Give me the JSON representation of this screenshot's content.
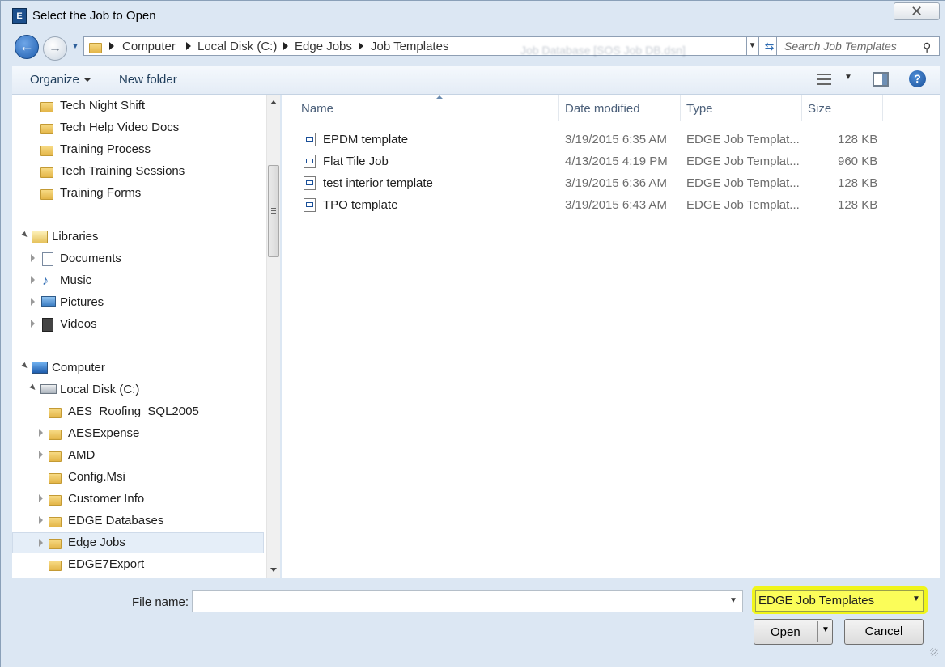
{
  "window": {
    "title": "Select the Job to Open",
    "app_icon_letter": "E"
  },
  "nav": {
    "breadcrumbs": [
      "Computer",
      "Local Disk (C:)",
      "Edge Jobs",
      "Job Templates"
    ],
    "search_placeholder": "Search Job Templates",
    "background_blur_text": "Job Database [SOS Job DB.dsn]"
  },
  "toolbar": {
    "organize": "Organize",
    "new_folder": "New folder"
  },
  "navpane": {
    "top_folders": [
      "Tech Night Shift",
      "Tech Help Video Docs",
      "Training Process",
      "Tech Training Sessions",
      "Training Forms"
    ],
    "libraries_label": "Libraries",
    "libraries": [
      "Documents",
      "Music",
      "Pictures",
      "Videos"
    ],
    "computer_label": "Computer",
    "local_disk_label": "Local Disk (C:)",
    "disk_folders": [
      "AES_Roofing_SQL2005",
      "AESExpense",
      "AMD",
      "Config.Msi",
      "Customer Info",
      "EDGE Databases",
      "Edge Jobs",
      "EDGE7Export"
    ],
    "selected_folder": "Edge Jobs"
  },
  "files": {
    "columns": [
      "Name",
      "Date modified",
      "Type",
      "Size"
    ],
    "rows": [
      {
        "name": "EPDM template",
        "date": "3/19/2015 6:35 AM",
        "type": "EDGE Job Templat...",
        "size": "128 KB"
      },
      {
        "name": "Flat Tile Job",
        "date": "4/13/2015 4:19 PM",
        "type": "EDGE Job Templat...",
        "size": "960 KB"
      },
      {
        "name": "test interior template",
        "date": "3/19/2015 6:36 AM",
        "type": "EDGE Job Templat...",
        "size": "128 KB"
      },
      {
        "name": "TPO template",
        "date": "3/19/2015 6:43 AM",
        "type": "EDGE Job Templat...",
        "size": "128 KB"
      }
    ]
  },
  "footer": {
    "file_name_label": "File name:",
    "file_name_value": "",
    "file_type_filter": "EDGE Job Templates",
    "open": "Open",
    "cancel": "Cancel"
  },
  "colors": {
    "highlight": "#f0f51a",
    "chrome": "#dce7f3",
    "accent": "#1f5dad"
  }
}
